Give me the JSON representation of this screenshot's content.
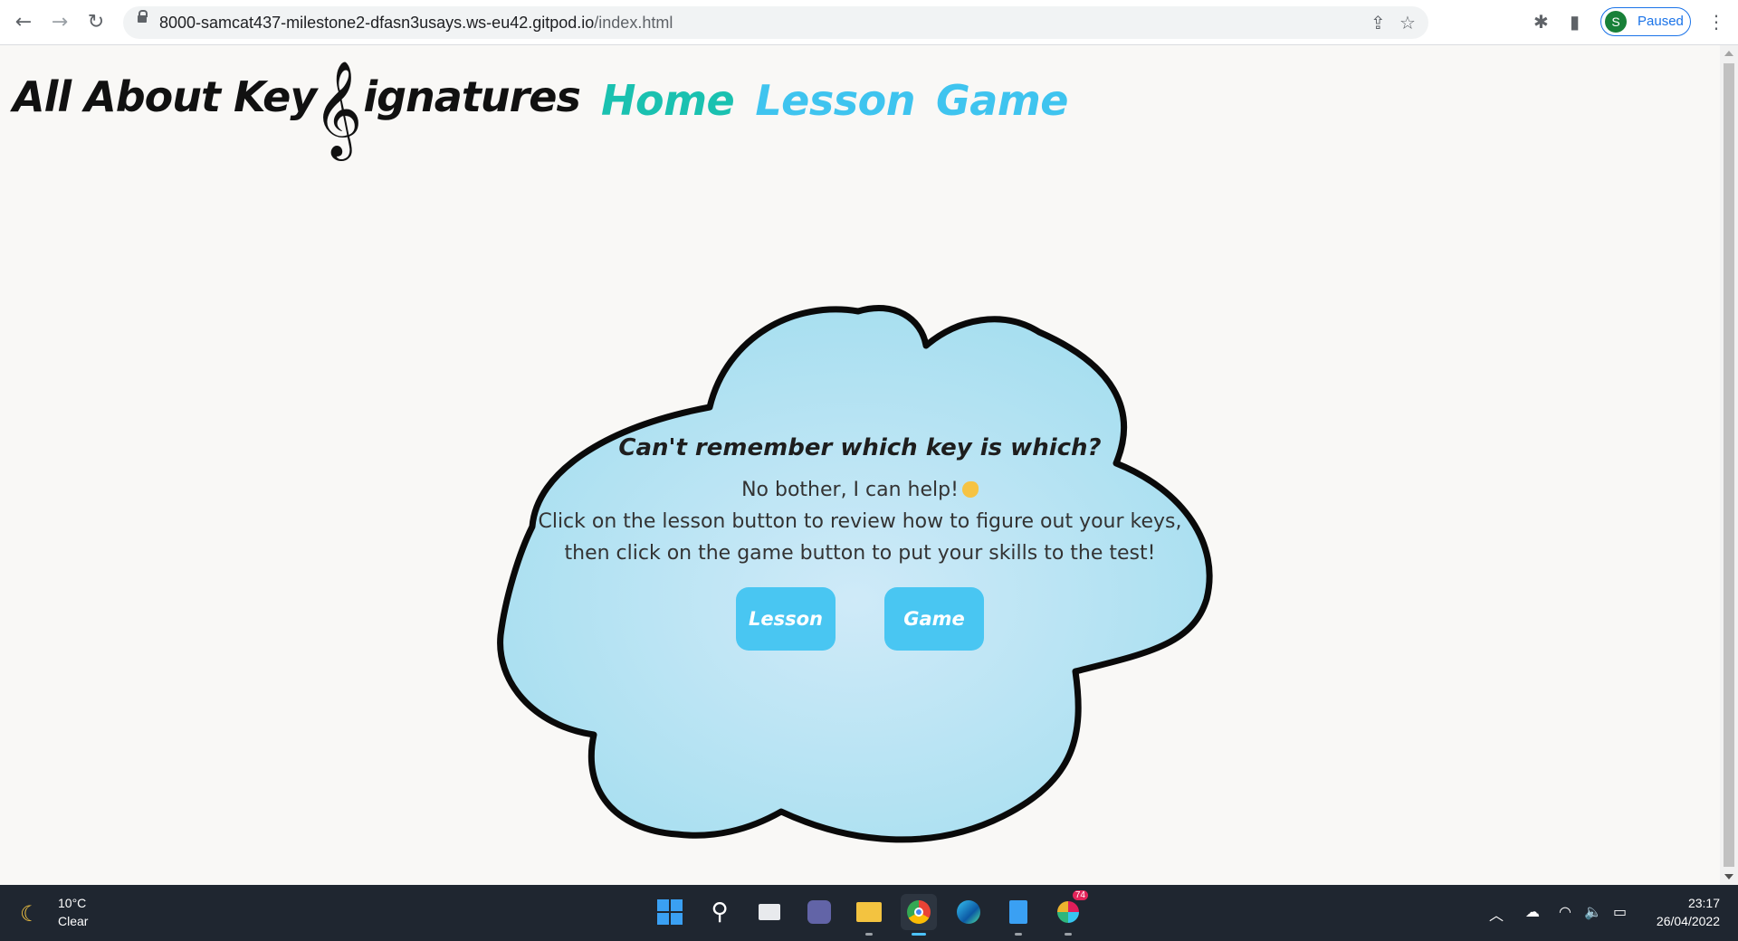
{
  "browser": {
    "url_host": "8000-samcat437-milestone2-dfasn3usays.ws-eu42.gitpod.io",
    "url_path": "/index.html",
    "profile_initial": "S",
    "profile_status": "Paused"
  },
  "site": {
    "title_before": "All About Key",
    "clef_glyph": "𝄞",
    "title_after": "ignatures",
    "nav": [
      "Home",
      "Lesson",
      "Game"
    ]
  },
  "cloud": {
    "heading": "Can't remember which key is which?",
    "line1": "No bother, I can help!",
    "line2": "Click on the lesson button to review how to figure out your keys,",
    "line3": "then click on the game button to put your skills to the test!",
    "buttons": [
      "Lesson",
      "Game"
    ],
    "fill_color": "#a8dff0",
    "button_color": "#49c6f2"
  },
  "taskbar": {
    "temperature": "10°C",
    "condition": "Clear",
    "time": "23:17",
    "date": "26/04/2022",
    "notification_count": "74",
    "apps": [
      "start-icon",
      "search-icon",
      "task-view-icon",
      "teams-icon",
      "file-explorer-icon",
      "chrome-icon",
      "edge-icon",
      "notepad-icon",
      "slack-icon"
    ]
  },
  "colors": {
    "nav_home": "#1ac1b0",
    "nav_other": "#3fc4ef",
    "taskbar_bg": "#1f2630"
  }
}
